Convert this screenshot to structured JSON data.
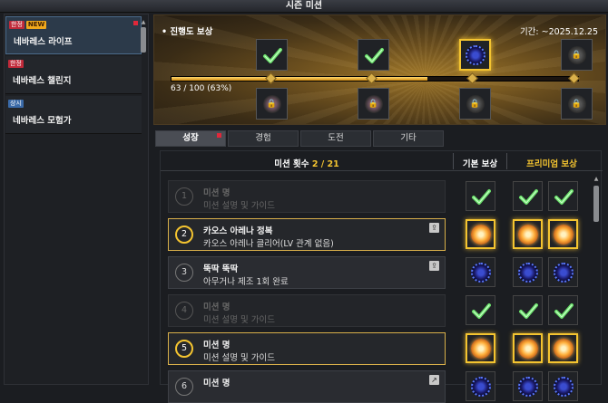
{
  "window": {
    "title": "시즌 미션"
  },
  "sidebar": {
    "items": [
      {
        "tags": [
          "한정",
          "NEW"
        ],
        "name": "네바레스 라이프",
        "active": true,
        "dot": true
      },
      {
        "tags": [
          "한정"
        ],
        "name": "네바레스 챌린지",
        "active": false,
        "dot": false
      },
      {
        "tags": [
          "상시"
        ],
        "name": "네바레스 모험가",
        "active": false,
        "dot": false
      }
    ]
  },
  "banner": {
    "title": "• 진행도 보상",
    "period": "기간: ~2025.12.25",
    "progress_text": "63 / 100 (63%)",
    "progress": 0.63,
    "top_rewards": [
      "check",
      "check",
      "gear",
      "lock"
    ],
    "bottom_rewards": [
      "lock",
      "lock",
      "lock",
      "lock"
    ]
  },
  "tabs": [
    {
      "label": "성장",
      "active": true,
      "dot": true
    },
    {
      "label": "경험",
      "active": false,
      "dot": false
    },
    {
      "label": "도전",
      "active": false,
      "dot": false
    },
    {
      "label": "기타",
      "active": false,
      "dot": false
    }
  ],
  "mission_header": {
    "count_label": "미션 횟수",
    "count_value": "2 / 21",
    "basic_label": "기본 보상",
    "premium_label": "프리미엄 보상"
  },
  "missions": [
    {
      "num": "1",
      "title": "미션 명",
      "desc": "미션 설명 및 가이드",
      "state": "done",
      "goto": "",
      "basic": "check",
      "premium": [
        "check",
        "check"
      ],
      "gold": false
    },
    {
      "num": "2",
      "title": "카오스 아레나 정복",
      "desc": "카오스 아레나 클리어(LV 관계 없음)",
      "state": "highlight",
      "goto": "⇪",
      "basic": "orb",
      "premium": [
        "orb",
        "orb"
      ],
      "gold": true
    },
    {
      "num": "3",
      "title": "뚝딱 뚝딱",
      "desc": "아무거나 제조 1회 완료",
      "state": "normal",
      "goto": "⇪",
      "basic": "gear",
      "premium": [
        "gear",
        "gear"
      ],
      "gold": false
    },
    {
      "num": "4",
      "title": "미션 명",
      "desc": "미션 설명 및 가이드",
      "state": "done",
      "goto": "",
      "basic": "check",
      "premium": [
        "check",
        "check"
      ],
      "gold": false
    },
    {
      "num": "5",
      "title": "미션 명",
      "desc": "미션 설명 및 가이드",
      "state": "highlight",
      "goto": "",
      "basic": "orb",
      "premium": [
        "orb",
        "orb"
      ],
      "gold": true
    },
    {
      "num": "6",
      "title": "미션 명",
      "desc": "",
      "state": "normal",
      "goto": "↗",
      "basic": "gear",
      "premium": [
        "gear",
        "gear"
      ],
      "gold": false
    }
  ],
  "colors": {
    "accent": "#f4c430",
    "badge_red": "#c02a3a",
    "badge_blue": "#3a6aa8"
  }
}
